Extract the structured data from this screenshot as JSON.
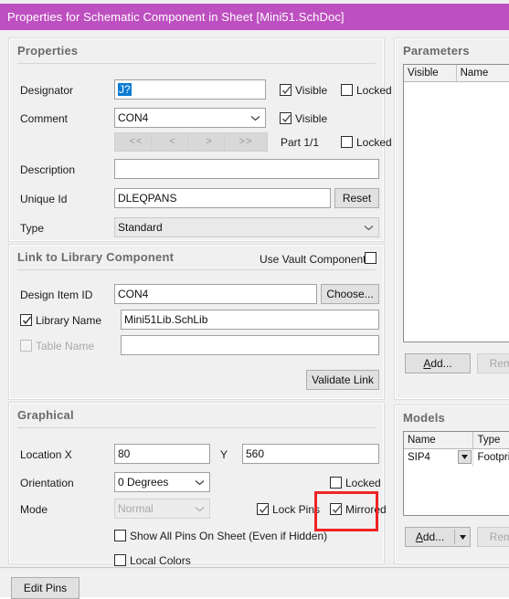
{
  "window": {
    "title": "Properties for Schematic Component in Sheet [Mini51.SchDoc]",
    "titlebar_color": "#bd4fc0",
    "annotation_color": "#ef2424"
  },
  "properties": {
    "title": "Properties",
    "designator": {
      "label": "Designator",
      "value": "J?",
      "visible_label": "Visible",
      "visible_checked": true,
      "locked_label": "Locked",
      "locked_checked": false
    },
    "comment": {
      "label": "Comment",
      "value": "CON4",
      "visible_label": "Visible",
      "visible_checked": true
    },
    "part_nav": {
      "first_label": "<<",
      "prev_label": "<",
      "next_label": ">",
      "last_label": ">>",
      "part_text": "Part 1/1",
      "locked_label": "Locked",
      "locked_checked": false
    },
    "description": {
      "label": "Description",
      "value": ""
    },
    "unique_id": {
      "label": "Unique Id",
      "value": "DLEQPANS",
      "reset_label": "Reset"
    },
    "type": {
      "label": "Type",
      "value": "Standard"
    }
  },
  "link_library": {
    "title": "Link to Library Component",
    "use_vault_label": "Use Vault Component",
    "use_vault_checked": false,
    "design_item_id": {
      "label": "Design Item ID",
      "value": "CON4",
      "choose_label": "Choose..."
    },
    "library_name": {
      "label": "Library Name",
      "value": "Mini51Lib.SchLib",
      "checked": true
    },
    "table_name": {
      "label": "Table Name",
      "value": "",
      "checked": false,
      "disabled": true
    },
    "validate_label": "Validate Link"
  },
  "graphical": {
    "title": "Graphical",
    "location": {
      "label": "Location  X",
      "x_value": "80",
      "y_label": "Y",
      "y_value": "560"
    },
    "orientation": {
      "label": "Orientation",
      "value": "0 Degrees"
    },
    "mode": {
      "label": "Mode",
      "value": "Normal",
      "disabled": true
    },
    "locked": {
      "label": "Locked",
      "checked": false
    },
    "lock_pins": {
      "label": "Lock Pins",
      "checked": true
    },
    "mirrored": {
      "label": "Mirrored",
      "checked": true,
      "highlighted": true
    },
    "show_all_pins": {
      "label": "Show All Pins On Sheet (Even if Hidden)",
      "checked": false
    },
    "local_colors": {
      "label": "Local Colors",
      "checked": false
    }
  },
  "parameters": {
    "title": "Parameters",
    "columns": [
      "Visible",
      "Name"
    ],
    "rows": [],
    "add_label": "Add...",
    "remove_label": "Remove",
    "remove_disabled": true
  },
  "models": {
    "title": "Models",
    "columns": [
      "Name",
      "Type"
    ],
    "rows": [
      {
        "name": "SIP4",
        "type": "Footprint"
      }
    ],
    "add_label": "Add...",
    "remove_label": "Remove",
    "remove_disabled": true
  },
  "footer": {
    "edit_pins_label": "Edit Pins"
  }
}
